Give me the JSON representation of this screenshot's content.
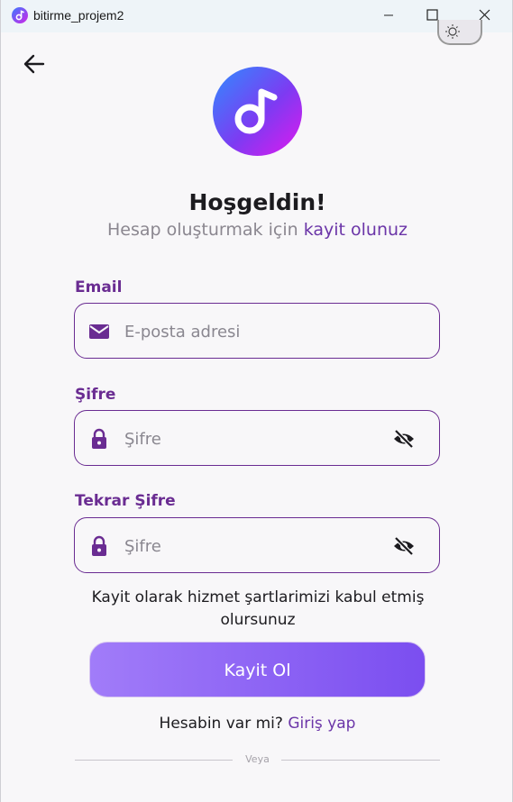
{
  "window": {
    "title": "bitirme_projem2"
  },
  "header": {
    "title": "Hoşgeldin!",
    "subtitle_prefix": "Hesap oluşturmak için",
    "subtitle_link": "kayit olunuz"
  },
  "form": {
    "email_label": "Email",
    "email_placeholder": "E-posta adresi",
    "password_label": "Şifre",
    "password_placeholder": "Şifre",
    "confirm_label": "Tekrar Şifre",
    "confirm_placeholder": "Şifre"
  },
  "terms_text": "Kayit olarak hizmet şartlarimizi kabul etmiş olursunuz",
  "register_button": "Kayit Ol",
  "login": {
    "prompt": "Hesabin var mi?",
    "link": "Giriş yap"
  },
  "divider_text": "Veya",
  "icons": {
    "app": "music-note-icon",
    "back": "arrow-left-icon",
    "theme": "sun-icon",
    "email": "mail-icon",
    "password": "lock-icon",
    "visibility": "eye-off-icon"
  },
  "colors": {
    "accent": "#6a2c92",
    "button_start": "#a17cf9",
    "button_end": "#7b4ef0"
  }
}
